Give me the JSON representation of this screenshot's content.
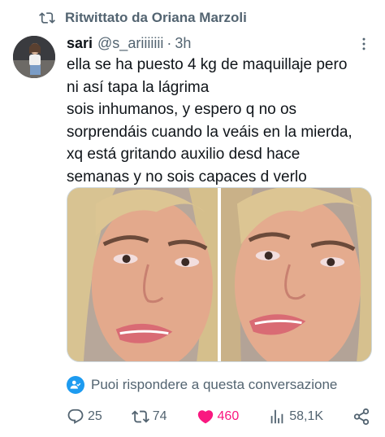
{
  "retweet": {
    "label": "Ritwittato da Oriana Marzoli",
    "icon": "retweet-icon"
  },
  "author": {
    "name": "sari",
    "handle": "@s_ariiiiiii",
    "separator": "·",
    "time": "3h"
  },
  "tweet": {
    "lines": [
      "ella se ha puesto 4 kg de maquillaje pero",
      "ni así tapa la lágrima",
      "sois inhumanos, y espero q no os",
      "sorprendáis cuando la veáis en la mierda,",
      "xq está gritando auxilio desd hace",
      "semanas y no sois capaces d verlo"
    ]
  },
  "reply_notice": {
    "text": "Puoi rispondere a questa conversazione",
    "icon": "person-check-icon"
  },
  "actions": {
    "replies": "25",
    "retweets": "74",
    "likes": "460",
    "views": "58,1K"
  },
  "colors": {
    "accent": "#1d9bf0",
    "like": "#f91880",
    "muted": "#536471",
    "text": "#0f1419"
  }
}
